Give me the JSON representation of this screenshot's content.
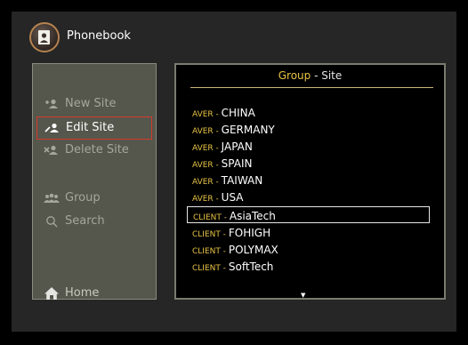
{
  "app": {
    "title": "Phonebook",
    "icon": "contact-book-icon"
  },
  "sidebar": {
    "items": [
      {
        "label": "New Site",
        "icon": "add-person-icon"
      },
      {
        "label": "Edit Site",
        "icon": "edit-person-icon"
      },
      {
        "label": "Delete Site",
        "icon": "remove-person-icon"
      },
      {
        "label": "Group",
        "icon": "group-people-icon"
      },
      {
        "label": "Search",
        "icon": "search-icon"
      },
      {
        "label": "Home",
        "icon": "home-icon"
      }
    ],
    "active_item": "Edit Site"
  },
  "panel": {
    "title_part1": "Group",
    "title_sep": " - ",
    "title_part2": "Site",
    "rows": [
      {
        "group": "AVER",
        "site": "CHINA"
      },
      {
        "group": "AVER",
        "site": "GERMANY"
      },
      {
        "group": "AVER",
        "site": "JAPAN"
      },
      {
        "group": "AVER",
        "site": "SPAIN"
      },
      {
        "group": "AVER",
        "site": "TAIWAN"
      },
      {
        "group": "AVER",
        "site": "USA"
      },
      {
        "group": "CLIENT",
        "site": "AsiaTech"
      },
      {
        "group": "CLIENT",
        "site": "FOHIGH"
      },
      {
        "group": "CLIENT",
        "site": "POLYMAX"
      },
      {
        "group": "CLIENT",
        "site": "SoftTech"
      }
    ],
    "selected_site": "AsiaTech",
    "separator": " - ",
    "scroll_indicator": "▼"
  },
  "colors": {
    "accent": "#e7c244",
    "active_border": "#d23a2b",
    "sidebar_bg": "#55564c"
  }
}
